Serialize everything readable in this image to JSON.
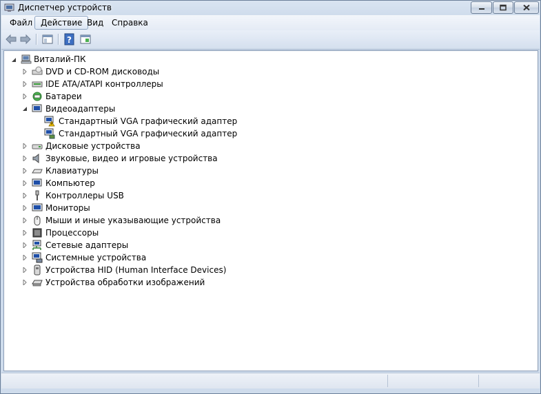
{
  "window": {
    "title": "Диспетчер устройств"
  },
  "menu": [
    {
      "id": "file",
      "label": "Файл"
    },
    {
      "id": "action",
      "label": "Действие"
    },
    {
      "id": "view",
      "label": "Вид"
    },
    {
      "id": "help",
      "label": "Справка"
    }
  ],
  "tree": {
    "root": "Виталий-ПК",
    "categories": [
      {
        "label": "DVD и CD-ROM дисководы",
        "icon": "dvd-drive-icon"
      },
      {
        "label": "IDE ATA/ATAPI контроллеры",
        "icon": "ide-controller-icon"
      },
      {
        "label": "Батареи",
        "icon": "battery-icon"
      },
      {
        "label": "Видеоадаптеры",
        "icon": "display-adapter-icon",
        "expanded": true,
        "children": [
          {
            "label": "Стандартный VGA графический адаптер",
            "warning": true
          },
          {
            "label": "Стандартный VGA графический адаптер",
            "warning": false
          }
        ]
      },
      {
        "label": "Дисковые устройства",
        "icon": "disk-drive-icon"
      },
      {
        "label": "Звуковые, видео и игровые устройства",
        "icon": "speaker-icon"
      },
      {
        "label": "Клавиатуры",
        "icon": "keyboard-icon"
      },
      {
        "label": "Компьютер",
        "icon": "computer-icon"
      },
      {
        "label": "Контроллеры USB",
        "icon": "usb-icon"
      },
      {
        "label": "Мониторы",
        "icon": "monitor-icon"
      },
      {
        "label": "Мыши и иные указывающие устройства",
        "icon": "mouse-icon"
      },
      {
        "label": "Процессоры",
        "icon": "processor-icon"
      },
      {
        "label": "Сетевые адаптеры",
        "icon": "network-adapter-icon"
      },
      {
        "label": "Системные устройства",
        "icon": "system-devices-icon"
      },
      {
        "label": "Устройства HID (Human Interface Devices)",
        "icon": "hid-icon"
      },
      {
        "label": "Устройства обработки изображений",
        "icon": "imaging-device-icon"
      }
    ]
  }
}
